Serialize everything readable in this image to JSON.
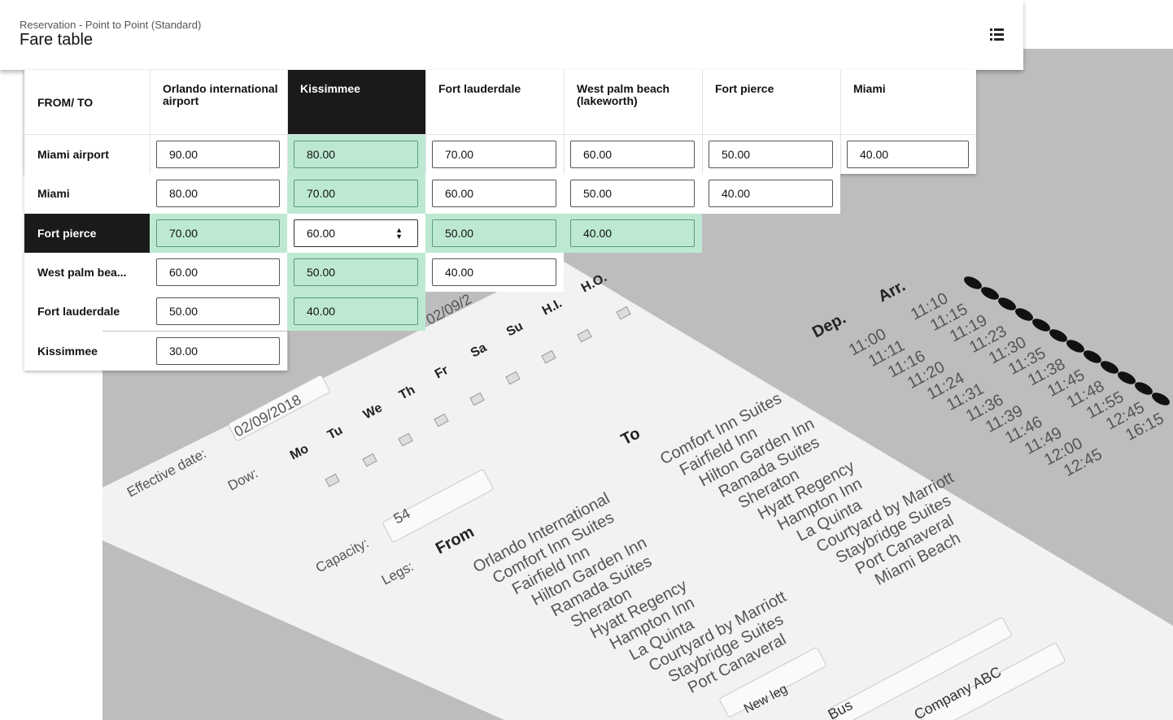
{
  "header": {
    "breadcrumb": "Reservation - Point to Point (Standard)",
    "title": "Fare table",
    "menu_icon": "list-icon"
  },
  "fare_table": {
    "corner_label": "FROM/ TO",
    "columns": [
      "Orlando international airport",
      "Kissimmee",
      "Fort lauderdale",
      "West palm beach (lakeworth)",
      "Fort pierce",
      "Miami"
    ],
    "highlight_column": "Kissimmee",
    "highlight_row": "Fort pierce",
    "rows": [
      {
        "label": "Miami airport",
        "values": [
          "90.00",
          "80.00",
          "70.00",
          "60.00",
          "50.00",
          "40.00"
        ]
      },
      {
        "label": "Miami",
        "values": [
          "80.00",
          "70.00",
          "60.00",
          "50.00",
          "40.00"
        ]
      },
      {
        "label": "Fort pierce",
        "values": [
          "70.00",
          "60.00",
          "50.00",
          "40.00"
        ]
      },
      {
        "label": "West palm bea...",
        "values": [
          "60.00",
          "50.00",
          "40.00"
        ]
      },
      {
        "label": "Fort lauderdale",
        "values": [
          "50.00",
          "40.00"
        ]
      },
      {
        "label": "Kissimmee",
        "values": [
          "30.00"
        ]
      }
    ]
  },
  "background_form": {
    "effective_date_label": "Effective date:",
    "effective_date": "02/09/2018",
    "effective_date_2": "02/09/2",
    "dow_label": "Dow:",
    "days": [
      "Mo",
      "Tu",
      "We",
      "Th",
      "Fr",
      "Sa",
      "Su",
      "H.I.",
      "H.O."
    ],
    "capacity_label": "Capacity:",
    "capacity": "54",
    "legs_label": "Legs:",
    "from_label": "From",
    "to_label": "To",
    "dep_label": "Dep.",
    "arr_label": "Arr.",
    "from_stops": [
      "Orlando International",
      "Comfort Inn Suites",
      "Fairfield Inn",
      "Hilton Garden Inn",
      "Ramada Suites",
      "Sheraton",
      "Hyatt Regency",
      "Hampton Inn",
      "La Quinta",
      "Courtyard by Marriott",
      "Staybridge Suites",
      "Port Canaveral"
    ],
    "to_stops": [
      "Comfort Inn Suites",
      "Fairfield Inn",
      "Hilton Garden Inn",
      "Ramada Suites",
      "Sheraton",
      "Hyatt Regency",
      "Hampton Inn",
      "La Quinta",
      "Courtyard by Marriott",
      "Staybridge Suites",
      "Port Canaveral",
      "Miami Beach"
    ],
    "dep_times": [
      "11:00",
      "11:11",
      "11:16",
      "11:20",
      "11:24",
      "11:31",
      "11:36",
      "11:39",
      "11:46",
      "11:49",
      "12:00",
      "12:45"
    ],
    "arr_times": [
      "11:10",
      "11:15",
      "11:19",
      "11:23",
      "11:30",
      "11:35",
      "11:38",
      "11:45",
      "11:48",
      "11:55",
      "12:45",
      "16:15"
    ],
    "new_leg_button": "New leg",
    "vehicle_field": "Bus",
    "company_field": "Company ABC"
  }
}
